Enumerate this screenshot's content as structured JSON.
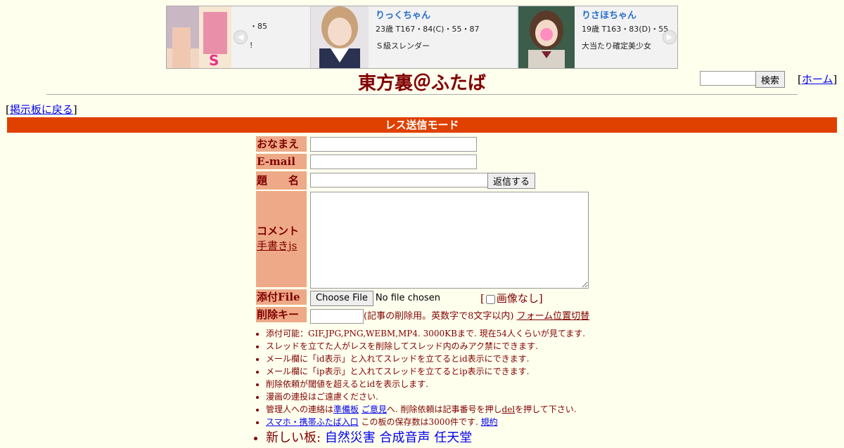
{
  "banner": {
    "card1": {
      "line1": "・85",
      "line2": "!"
    },
    "card2": {
      "name": "りっくちゃん",
      "stats": "23歳 T167・84(C)・55・87",
      "desc": "Ｓ級スレンダー"
    },
    "card3": {
      "name": "りさほちゃん",
      "stats": "19歳 T163・83(D)・55",
      "desc": "大当たり確定美少女"
    },
    "poster_text": "S"
  },
  "header": {
    "title": "東方裏＠ふたば",
    "search_button": "検索",
    "home_link": "ホーム",
    "back_link": "掲示板に戻る"
  },
  "mode_bar": "レス送信モード",
  "form": {
    "name_label": "おなまえ",
    "email_label": "E-mail",
    "subject_label": "題　　名",
    "submit_button": "返信する",
    "comment_label": "コメント",
    "handwriting_link": "手書きjs",
    "file_label": "添付File",
    "file_button": "Choose File",
    "file_status": "No file chosen",
    "no_image_label": "画像なし",
    "delkey_label": "削除キー",
    "delkey_note": "(記事の削除用。英数字で8文字以内)",
    "form_position_link": "フォーム位置切替"
  },
  "notes": {
    "n1": "添付可能：GIF,JPG,PNG,WEBM,MP4. 3000KBまで. 現在54人くらいが見てます.",
    "n2": "スレッドを立てた人がレスを削除してスレッド内のみアク禁にできます.",
    "n3": "メール欄に「id表示」と入れてスレッドを立てるとid表示にできます.",
    "n4": "メール欄に「ip表示」と入れてスレッドを立てるとip表示にできます.",
    "n5": "削除依頼が閾値を超えるとidを表示します.",
    "n6": "漫画の連投はご遠慮ください.",
    "n7_pre": "管理人への連絡は",
    "n7_link1": "準備板",
    "n7_link2": "ご意見",
    "n7_mid": "へ. 削除依頼は記事番号を押し",
    "n7_del": "del",
    "n7_post": "を押して下さい.",
    "n8_link": "スマホ・携帯ふたば入口",
    "n8_mid": " この板の保存数は3000件です.",
    "n8_link2": "規約",
    "n9_pre": "新しい板:",
    "n9_links": [
      "自然災害",
      "合成音声",
      "任天堂"
    ]
  },
  "colors": {
    "background": "#ffffee",
    "text": "#800000",
    "mode_bar": "#e04000",
    "label_bg": "#eeaa88",
    "link": "#0000ee"
  }
}
